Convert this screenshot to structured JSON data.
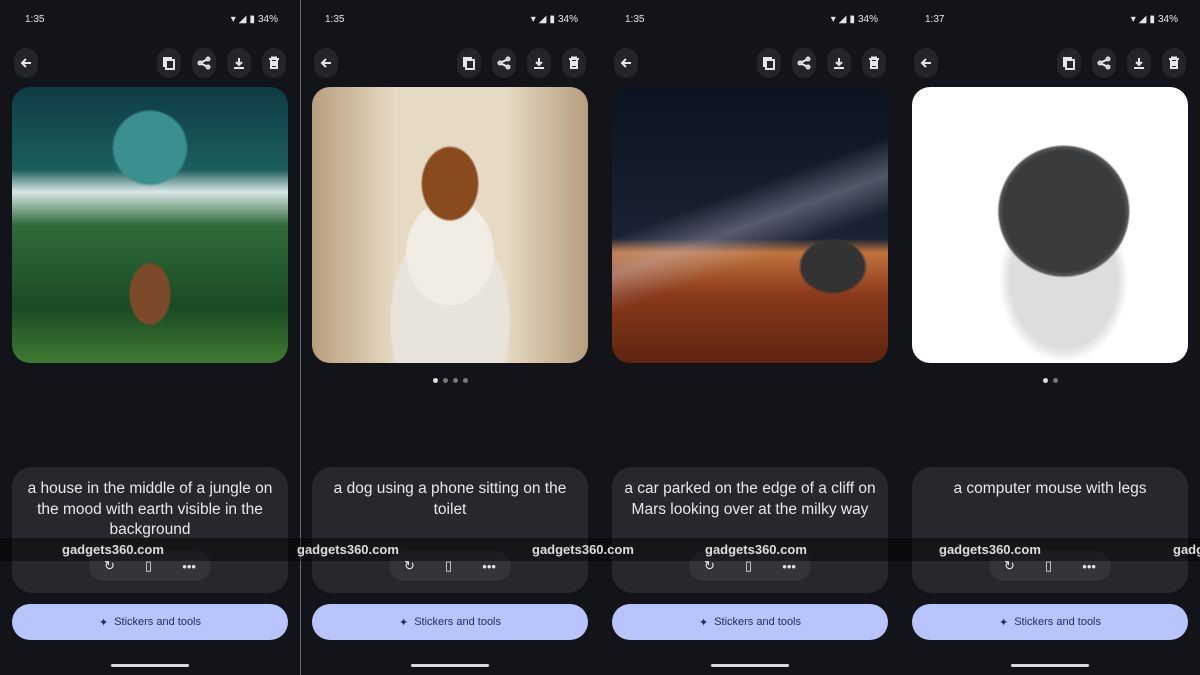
{
  "panels": [
    {
      "time": "1:35",
      "battery": "34%",
      "prompt": "a house in the middle of a jungle on the mood with earth visible in the background",
      "dots": 0,
      "active_dot": 0,
      "image": "jungle-house-moon"
    },
    {
      "time": "1:35",
      "battery": "34%",
      "prompt": "a dog using a phone sitting on the toilet",
      "dots": 4,
      "active_dot": 0,
      "image": "dog-toilet-phones"
    },
    {
      "time": "1:35",
      "battery": "34%",
      "prompt": "a car parked on the edge of a cliff on Mars looking over at the milky way",
      "dots": 0,
      "active_dot": 0,
      "image": "car-mars-milkyway"
    },
    {
      "time": "1:37",
      "battery": "34%",
      "prompt": "a computer mouse with legs",
      "dots": 2,
      "active_dot": 0,
      "image": "mouse-with-legs"
    }
  ],
  "stickers_label": "Stickers and tools",
  "more_label": "•••",
  "watermark": [
    "gadgets360.com",
    "gadgets360.com",
    "gadgets360.com",
    "gadgets360.com",
    "gadgets360.com",
    "gadg"
  ],
  "colors": {
    "background": "#131419",
    "card": "#27282d",
    "accent_button": "#b8c4fb",
    "accent_text": "#1f2f66"
  }
}
